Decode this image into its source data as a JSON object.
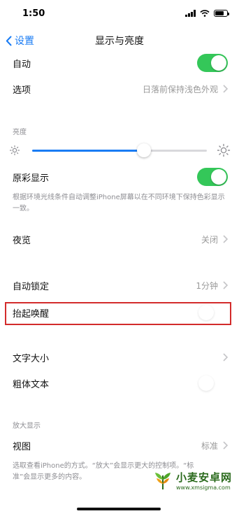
{
  "status_bar": {
    "time": "1:50"
  },
  "nav": {
    "back_label": "设置",
    "title": "显示与亮度"
  },
  "rows": {
    "auto": {
      "label": "自动",
      "toggle": "on"
    },
    "options": {
      "label": "选项",
      "value": "日落前保持浅色外观"
    },
    "true_tone": {
      "label": "原彩显示",
      "toggle": "on"
    },
    "night_shift": {
      "label": "夜览",
      "value": "关闭"
    },
    "auto_lock": {
      "label": "自动锁定",
      "value": "1分钟"
    },
    "raise_to_wake": {
      "label": "抬起唤醒",
      "toggle": "off"
    },
    "text_size": {
      "label": "文字大小"
    },
    "bold_text": {
      "label": "粗体文本",
      "toggle": "off"
    },
    "view": {
      "label": "视图",
      "value": "标准"
    }
  },
  "sections": {
    "brightness_header": "亮度",
    "true_tone_footnote": "根据环境光线条件自动调整iPhone屏幕以在不同环境下保持色彩显示一致。",
    "zoom_header": "放大显示",
    "zoom_footnote": "选取查看iPhone的方式。“放大”会显示更大的控制项。“标准”会显示更多的内容。"
  },
  "brightness": {
    "level": 0.64
  },
  "colors": {
    "accent": "#1a7cf4",
    "toggle_on": "#34c759",
    "highlight": "#d32b2b"
  },
  "watermark": {
    "title": "小麦安卓网",
    "url": "www.xmsigma.com"
  }
}
